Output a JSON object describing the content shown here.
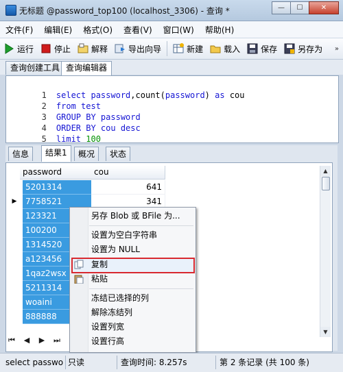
{
  "window": {
    "title": "无标题 @password_top100 (localhost_3306) - 查询 *",
    "minimize_glyph": "—",
    "maximize_glyph": "☐",
    "close_glyph": "✕"
  },
  "menu": [
    "文件(F)",
    "编辑(E)",
    "格式(O)",
    "查看(V)",
    "窗口(W)",
    "帮助(H)"
  ],
  "toolbar": {
    "run": "运行",
    "stop": "停止",
    "explain": "解释",
    "export": "导出向导",
    "new": "新建",
    "load": "载入",
    "save": "保存",
    "save_as": "另存为",
    "more": "»"
  },
  "top_tabs": [
    "查询创建工具",
    "查询编辑器"
  ],
  "editor": {
    "lines": [
      {
        "num": "1",
        "parts": [
          "select password",
          ",",
          "count",
          "(",
          "password",
          ")",
          " as ",
          "cou"
        ]
      },
      {
        "num": "2",
        "parts": [
          "from test"
        ]
      },
      {
        "num": "3",
        "parts": [
          "GROUP BY password"
        ]
      },
      {
        "num": "4",
        "parts": [
          "ORDER BY cou desc"
        ]
      },
      {
        "num": "5",
        "parts": [
          "limit ",
          "100"
        ]
      }
    ]
  },
  "result_tabs": [
    "信息",
    "结果1",
    "概况",
    "状态"
  ],
  "grid": {
    "columns": [
      "password",
      "cou"
    ],
    "rows": [
      {
        "password": "5201314",
        "cou": "641"
      },
      {
        "password": "7758521",
        "cou": "341"
      },
      {
        "password": "123321",
        "cou": ""
      },
      {
        "password": "100200",
        "cou": ""
      },
      {
        "password": "1314520",
        "cou": ""
      },
      {
        "password": "a123456",
        "cou": ""
      },
      {
        "password": "1qaz2wsx",
        "cou": ""
      },
      {
        "password": "5211314",
        "cou": ""
      },
      {
        "password": "woaini",
        "cou": ""
      },
      {
        "password": "888888",
        "cou": ""
      }
    ],
    "current_row_marker": "▶"
  },
  "nav": [
    "⏮",
    "◀",
    "▶",
    "⏭"
  ],
  "context_menu": {
    "items": [
      "另存 Blob 或 BFile 为...",
      "设置为空白字符串",
      "设置为 NULL",
      "复制",
      "粘贴",
      "冻结已选择的列",
      "解除冻结列",
      "设置列宽",
      "设置行高"
    ]
  },
  "status": {
    "sql": "select password,count(password) as cou",
    "mode": "只读",
    "time": "查询时间: 8.257s",
    "record": "第 2 条记录 (共 100 条)"
  },
  "colors": {
    "selection": "#3a9be0",
    "keyword": "#1515d4",
    "number": "#009000",
    "highlight_border": "#d8282e"
  }
}
